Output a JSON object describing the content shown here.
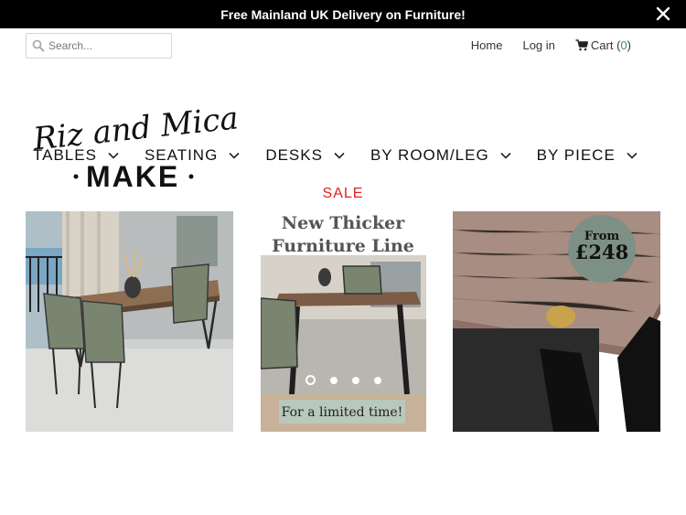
{
  "announcement": {
    "text": "Free Mainland UK Delivery on Furniture!"
  },
  "search": {
    "placeholder": "Search..."
  },
  "toplinks": {
    "home": "Home",
    "login": "Log in",
    "cart_label": "Cart",
    "cart_count": "0"
  },
  "logo": {
    "line1": "Riz and Mica",
    "line2": "MAKE"
  },
  "nav": [
    {
      "label": "TABLES"
    },
    {
      "label": "SEATING"
    },
    {
      "label": "DESKS"
    },
    {
      "label": "BY ROOM/LEG"
    },
    {
      "label": "BY PIECE"
    }
  ],
  "sale": "SALE",
  "slides": {
    "middle_title_1": "New Thicker",
    "middle_title_2": "Furniture Line",
    "middle_caption": "For a limited time!",
    "badge_from": "From",
    "badge_price": "£248"
  },
  "carousel": {
    "count": 4,
    "active": 0
  },
  "colors": {
    "accent_sale": "#e0201b",
    "cart_count": "#2aa14b",
    "badge": "#7d9086"
  }
}
